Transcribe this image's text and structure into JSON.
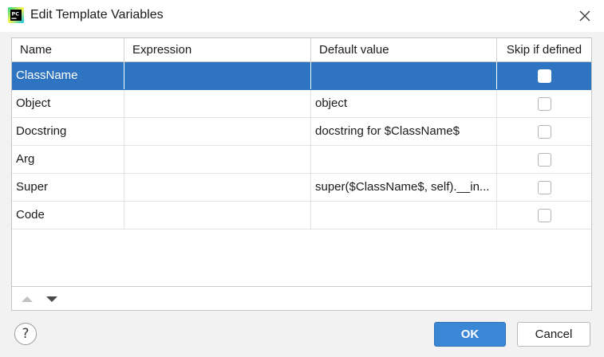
{
  "dialog": {
    "title": "Edit Template Variables",
    "app_icon": "pycharm-icon",
    "close_icon": "close-icon"
  },
  "table": {
    "columns": [
      "Name",
      "Expression",
      "Default value",
      "Skip if defined"
    ],
    "rows": [
      {
        "name": "ClassName",
        "expression": "",
        "default_value": "",
        "skip_if_defined": false,
        "selected": true
      },
      {
        "name": "Object",
        "expression": "",
        "default_value": "object",
        "skip_if_defined": false,
        "selected": false
      },
      {
        "name": "Docstring",
        "expression": "",
        "default_value": "docstring for $ClassName$",
        "skip_if_defined": false,
        "selected": false
      },
      {
        "name": "Arg",
        "expression": "",
        "default_value": "",
        "skip_if_defined": false,
        "selected": false
      },
      {
        "name": "Super",
        "expression": "",
        "default_value": "super($ClassName$, self).__in...",
        "skip_if_defined": false,
        "selected": false
      },
      {
        "name": "Code",
        "expression": "",
        "default_value": "",
        "skip_if_defined": false,
        "selected": false
      }
    ],
    "toolbar": {
      "move_up_icon": "arrow-up-icon",
      "move_down_icon": "arrow-down-icon"
    }
  },
  "footer": {
    "help_glyph": "?",
    "ok_label": "OK",
    "cancel_label": "Cancel"
  },
  "colors": {
    "selection": "#2f74c0",
    "primary_button": "#3b87d6"
  }
}
